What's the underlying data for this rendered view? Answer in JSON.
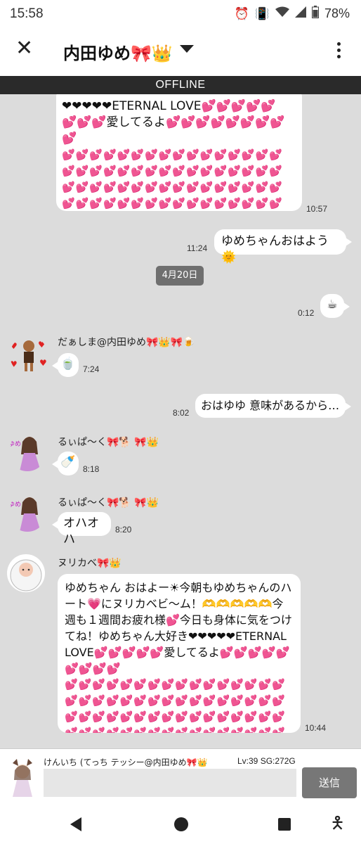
{
  "status_bar": {
    "time": "15:58",
    "icons": [
      "alarm-icon",
      "vibrate-icon",
      "wifi-icon",
      "signal-icon",
      "battery-icon"
    ],
    "battery": "78%"
  },
  "header": {
    "title": "内田ゆめ🎀👑"
  },
  "offline_label": "OFFLINE",
  "messages": {
    "m1": {
      "text_a": "❤❤❤❤❤ETERNAL LOVE💕💕💕💕💕",
      "text_b": "💕💕💕愛してるよ💕💕💕💕💕💕💕💕💕",
      "hearts": "💕💕💕💕💕💕💕💕💕💕💕💕💕💕💕💕💕💕💕💕💕💕💕💕💕💕💕💕💕💕💕💕💕💕💕💕💕💕💕💕💕💕💕💕💕💕💕💕💕💕💕💕💕💕💕💕💕💕💕💕💕💕💕💕💕💕💕💕💕💕💕💕💕💕💕💕💕💕💕💕💕💕💕💕💕💕💕💕💕💕💕💕💕💕💕💕💕💕💕💕💕💕💕💕💕💕💕💕💕💕💕💕💕💕💕💕💕💕💕💕💕",
      "time": "10:57"
    },
    "m2": {
      "text": "ゆめちゃんおはよう🌞",
      "time": "11:24"
    },
    "date_chip": "4月20日",
    "m3": {
      "text": "☕",
      "time": "0:12"
    },
    "m4": {
      "sender": "だぁしま@内田ゆめ🎀👑🎀🍺",
      "text": "🍵",
      "time": "7:24"
    },
    "m5": {
      "text": "おはゆゆ 意味があるから…",
      "time": "8:02"
    },
    "m6": {
      "sender": "るぃぱ〜く🎀🐕 🎀👑",
      "text": "🍼",
      "time": "8:18"
    },
    "m7": {
      "sender": "るぃぱ〜く🎀🐕 🎀👑",
      "text": "オハオハ",
      "time": "8:20"
    },
    "m8": {
      "sender": "ヌリカベ🎀👑",
      "text": "ゆめちゃん おはよー☀今朝もゆめちゃんのハート💗にヌリカベビ〜ム！🫶🫶🫶🫶🫶今週も１週間お疲れ様💕今日も身体に気をつけてね！ゆめちゃん大好き❤❤❤❤❤ETERNAL LOVE💕💕💕💕💕愛してるよ💕💕💕💕💕💕💕💕💕",
      "hearts": "💕💕💕💕💕💕💕💕💕💕💕💕💕💕💕💕💕💕💕💕💕💕💕💕💕💕💕💕💕💕💕💕💕💕💕💕💕💕💕💕💕💕💕💕💕💕💕💕💕💕💕💕💕💕💕💕💕💕💕💕💕💕💕💕💕💕💕💕💕💕💕💕💕💕💕💕💕💕💕💕💕💕💕💕💕💕💕💕💕💕💕💕💕💕💕💕💕💕",
      "time": "10:44"
    }
  },
  "input": {
    "username": "けんいち (てっち テッシー@内田ゆめ🎀👑",
    "stats": "Lv:39  SG:272G",
    "value": "",
    "send_label": "送信"
  },
  "nav": {
    "icons": [
      "back-icon",
      "home-icon",
      "recents-icon",
      "accessibility-icon"
    ]
  }
}
